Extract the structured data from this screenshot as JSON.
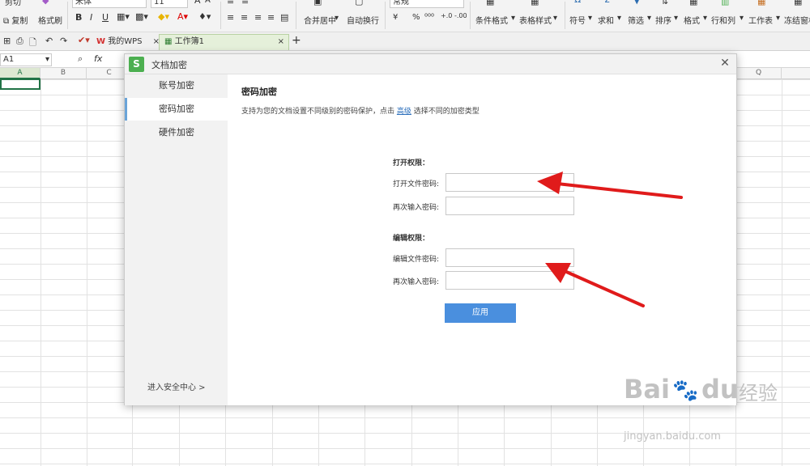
{
  "ribbon": {
    "cut": "剪切",
    "copy": "复制",
    "format_painter": "格式刷",
    "font_name": "宋体",
    "font_size": "11",
    "bold": "B",
    "italic": "I",
    "underline": "U",
    "merge_center": "合并居中",
    "wrap_text": "自动换行",
    "number_format": "常规",
    "currency": "¥",
    "percent": "%",
    "cond_format": "条件格式",
    "table_style": "表格样式",
    "symbol": "符号",
    "sum": "求和",
    "filter": "筛选",
    "sort": "排序",
    "format": "格式",
    "row_col": "行和列",
    "worksheet": "工作表",
    "freeze": "冻结窗格"
  },
  "tabs": {
    "wps": "我的WPS",
    "workbook": "工作簿1",
    "add": "+"
  },
  "formula_bar": {
    "cell_ref": "A1",
    "fx": "fx"
  },
  "columns": [
    "A",
    "B",
    "C",
    "Q"
  ],
  "dialog": {
    "title": "文档加密",
    "logo": "S",
    "nav": [
      "账号加密",
      "密码加密",
      "硬件加密"
    ],
    "security_center": "进入安全中心 >",
    "heading": "密码加密",
    "desc_before": "支持为您的文档设置不同级别的密码保护，点击",
    "desc_link": "高级",
    "desc_after": "选择不同的加密类型",
    "open_section": "打开权限：",
    "open_pwd_label": "打开文件密码:",
    "confirm_label": "再次输入密码:",
    "edit_section": "编辑权限：",
    "edit_pwd_label": "编辑文件密码:",
    "apply": "应用"
  },
  "watermark": {
    "brand_latin": "Bai",
    "brand_du": "du",
    "brand_cn": "经验",
    "url": "jingyan.baidu.com"
  },
  "colors": {
    "accent": "#4a8fde",
    "logo": "#4caf50",
    "arrow": "#e01b1b",
    "selection": "#217346"
  }
}
